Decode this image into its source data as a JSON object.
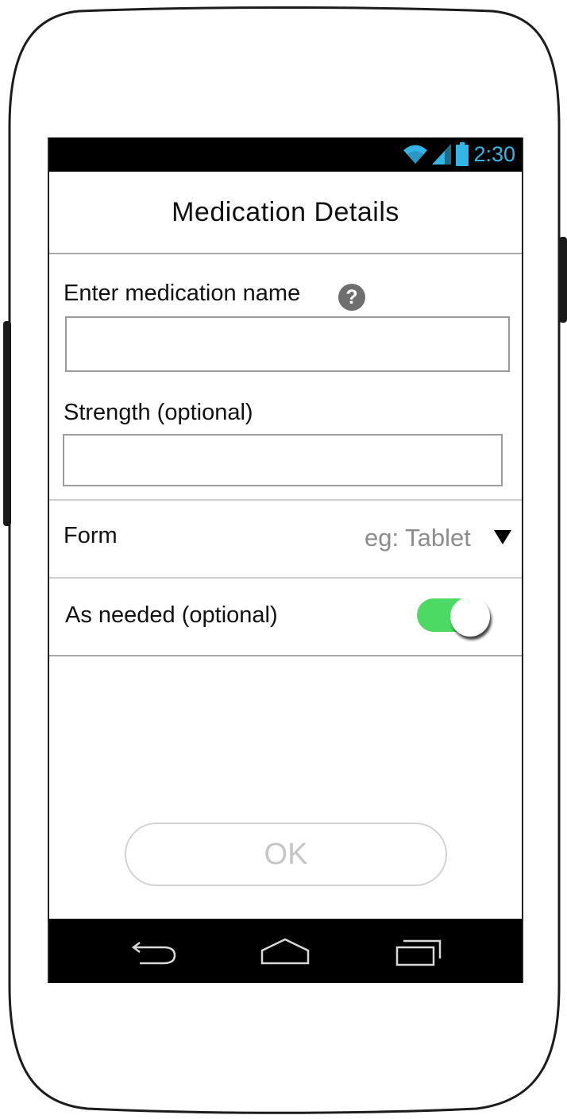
{
  "status_bar": {
    "time": "2:30",
    "icons": [
      "wifi-icon",
      "signal-icon",
      "battery-icon"
    ],
    "accent_color": "#33b5e5"
  },
  "header": {
    "title": "Medication Details"
  },
  "form": {
    "medication_name": {
      "label": "Enter medication name",
      "value": "",
      "help_icon": "help-icon"
    },
    "strength": {
      "label": "Strength (optional)",
      "value": ""
    },
    "form_select": {
      "label": "Form",
      "selected": "eg: Tablet",
      "icon": "dropdown-arrow-icon"
    },
    "as_needed": {
      "label": "As needed (optional)",
      "on": true,
      "color": "#4cd964"
    }
  },
  "actions": {
    "ok_label": "OK"
  },
  "nav_bar": {
    "icons": [
      "back-icon",
      "home-icon",
      "recent-apps-icon"
    ]
  }
}
